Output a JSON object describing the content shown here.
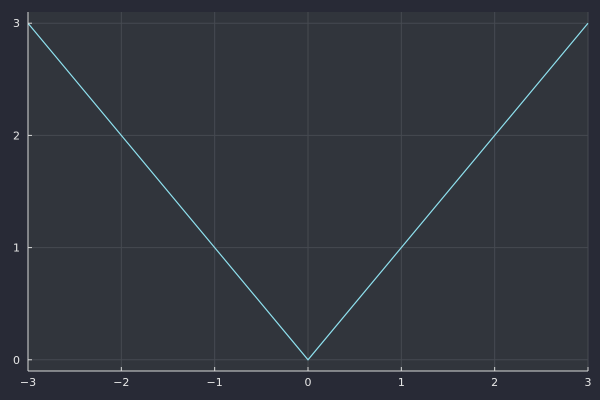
{
  "chart_data": {
    "type": "line",
    "title": "",
    "xlabel": "",
    "ylabel": "",
    "xlim": [
      -3,
      3
    ],
    "ylim": [
      -0.1,
      3.1
    ],
    "xticks": [
      -3,
      -2,
      -1,
      0,
      1,
      2,
      3
    ],
    "xtick_labels": [
      "−3",
      "−2",
      "−1",
      "0",
      "1",
      "2",
      "3"
    ],
    "yticks": [
      0,
      1,
      2,
      3
    ],
    "ytick_labels": [
      "0",
      "1",
      "2",
      "3"
    ],
    "grid": true,
    "legend": "none",
    "series": [
      {
        "x": [
          -3,
          0,
          3
        ],
        "y": [
          3,
          0,
          3
        ],
        "color": "#8fe1ef"
      }
    ]
  },
  "colors": {
    "background": "#282a36",
    "plot_background": "#31353c",
    "axis": "#d9d9d9",
    "grid": "#464a51",
    "text": "#e6e6e6"
  }
}
